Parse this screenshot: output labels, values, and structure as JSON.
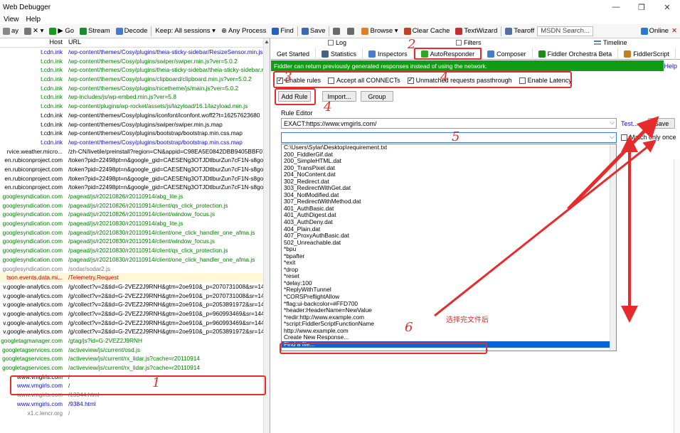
{
  "window": {
    "title": "Web Debugger",
    "minimize": "—",
    "restore": "❐",
    "close": "✕"
  },
  "menu": [
    "View",
    "Help"
  ],
  "toolbar": {
    "items": [
      {
        "label": "ay",
        "icon": "replay-icon",
        "color": "#888888"
      },
      {
        "label": "✕ ▾",
        "icon": "remove-icon",
        "color": "#777777"
      },
      {
        "label": "▶ Go",
        "icon": "go-icon",
        "color": "#1a9a1a"
      },
      {
        "label": "Stream",
        "icon": "stream-icon",
        "color": "#1b8a2c"
      },
      {
        "label": "Decode",
        "icon": "decode-icon",
        "color": "#4a7acb"
      },
      {
        "label": "Keep: All sessions ▾",
        "icon": "",
        "color": ""
      },
      {
        "label": "⊕ Any Process",
        "icon": "",
        "color": ""
      },
      {
        "label": "Find",
        "icon": "find-icon",
        "color": "#2060c0"
      },
      {
        "label": "Save",
        "icon": "save-icon",
        "color": "#3a6ab0"
      },
      {
        "label": "",
        "icon": "screenshot-icon",
        "color": "#6a6a6a"
      },
      {
        "label": "",
        "icon": "timer-icon",
        "color": "#6a6a6a"
      },
      {
        "label": "Browse ▾",
        "icon": "browse-icon",
        "color": "#e08020"
      },
      {
        "label": "Clear Cache",
        "icon": "clear-cache-icon",
        "color": "#c04020"
      },
      {
        "label": "TextWizard",
        "icon": "textwizard-icon",
        "color": "#c03030"
      },
      {
        "label": "Tearoff",
        "icon": "tearoff-icon",
        "color": "#5070a0"
      }
    ],
    "search_placeholder": "MSDN Search...",
    "online": "Online",
    "online_close": "✕"
  },
  "sessions": {
    "header_host": "Host",
    "header_url": "URL",
    "rows": [
      {
        "host": "t.cdn.ink",
        "url": "/wp-content/themes/Cosy/plugins/theia-sticky-sidebar/ResizeSensor.min.js?",
        "color": "blue",
        "bg": ""
      },
      {
        "host": "t.cdn.ink",
        "url": "/wp-content/themes/Cosy/plugins/swiper/swiper.min.js?ver=5.0.2",
        "color": "green",
        "bg": ""
      },
      {
        "host": "t.cdn.ink",
        "url": "/wp-content/themes/Cosy/plugins/theia-sticky-sidebar/theia-sticky-sidebar.r",
        "color": "green",
        "bg": ""
      },
      {
        "host": "t.cdn.ink",
        "url": "/wp-content/themes/Cosy/plugins/clipboard/clipboard.min.js?ver=5.0.2",
        "color": "green",
        "bg": ""
      },
      {
        "host": "t.cdn.ink",
        "url": "/wp-content/themes/Cosy/plugins/nicetheme/js/main.js?ver=5.0.2",
        "color": "green",
        "bg": ""
      },
      {
        "host": "t.cdn.ink",
        "url": "/wp-includes/js/wp-embed.min.js?ver=5.8",
        "color": "green",
        "bg": ""
      },
      {
        "host": "t.cdn.ink",
        "url": "/wp-content/plugins/wp-rocket/assets/js/lazyload/16.1/lazyload.min.js",
        "color": "green",
        "bg": ""
      },
      {
        "host": "t.cdn.ink",
        "url": "/wp-content/themes/Cosy/plugins/iconfont/iconfont.woff2?t=16257623680",
        "color": "black",
        "bg": ""
      },
      {
        "host": "t.cdn.ink",
        "url": "/wp-content/themes/Cosy/plugins/swiper/swiper.min.js.map",
        "color": "black",
        "bg": ""
      },
      {
        "host": "t.cdn.ink",
        "url": "/wp-content/themes/Cosy/plugins/bootstrap/bootstrap.min.css.map",
        "color": "black",
        "bg": ""
      },
      {
        "host": "t.cdn.ink",
        "url": "/wp-content/themes/Cosy/plugins/bootstrap/bootstrap.min.css.map",
        "color": "blue",
        "bg": ""
      },
      {
        "host": "rvice.weather.micro...",
        "url": "/zh-CN/livetile/preinstall?region=CN&appid=C98EA5E0842DBB9405BBF071E",
        "color": "black",
        "bg": ""
      },
      {
        "host": "en.rubiconproject.com",
        "url": "/token?pid=22498pt=n&google_gid=CAESENg3OTJDtlburZun7cF1N-s8goog",
        "color": "black",
        "bg": ""
      },
      {
        "host": "en.rubiconproject.com",
        "url": "/token?pid=22498pt=n&google_gid=CAESENg3OTJDtlburZun7cF1N-s8goog",
        "color": "black",
        "bg": ""
      },
      {
        "host": "en.rubiconproject.com",
        "url": "/token?pid=22498pt=n&google_gid=CAESENg3OTJDtlburZun7cF1N-s8goog",
        "color": "black",
        "bg": ""
      },
      {
        "host": "en.rubiconproject.com",
        "url": "/token?pid=22498pt=n&google_gid=CAESENg3OTJDtlburZun7cF1N-s8goog",
        "color": "black",
        "bg": ""
      },
      {
        "host": "googlesyndication.com",
        "url": "/pagead/js/r20210826/r20110914/abg_lite.js",
        "color": "green",
        "bg": ""
      },
      {
        "host": "googlesyndication.com",
        "url": "/pagead/js/r20210826/r20110914/client/qs_click_protection.js",
        "color": "green",
        "bg": ""
      },
      {
        "host": "googlesyndication.com",
        "url": "/pagead/js/r20210826/r20110914/client/window_focus.js",
        "color": "green",
        "bg": ""
      },
      {
        "host": "googlesyndication.com",
        "url": "/pagead/js/r20210830/r20110914/abg_lite.js",
        "color": "green",
        "bg": ""
      },
      {
        "host": "googlesyndication.com",
        "url": "/pagead/js/r20210830/r20110914/client/one_click_handler_one_afma.js",
        "color": "green",
        "bg": ""
      },
      {
        "host": "googlesyndication.com",
        "url": "/pagead/js/r20210830/r20110914/client/window_focus.js",
        "color": "green",
        "bg": ""
      },
      {
        "host": "googlesyndication.com",
        "url": "/pagead/js/r20210830/r20110914/client/qs_click_protection.js",
        "color": "green",
        "bg": ""
      },
      {
        "host": "googlesyndication.com",
        "url": "/pagead/js/r20210830/r20110914/client/one_click_handler_one_afma.js",
        "color": "green",
        "bg": ""
      },
      {
        "host": "googlesyndication.com",
        "url": "/sodar/sodar2.js",
        "color": "gray",
        "bg": ""
      },
      {
        "host": "tson.events.data.mi...",
        "url": "/Telemetry.Request",
        "color": "red",
        "bg": "y"
      },
      {
        "host": "v.google-analytics.com",
        "url": "/g/collect?v=2&tid=G-2VEZ2J9RNH&gtm=2oe910&_p=2070731008&sr=144",
        "color": "black",
        "bg": ""
      },
      {
        "host": "v.google-analytics.com",
        "url": "/g/collect?v=2&tid=G-2VEZ2J9RNH&gtm=2oe910&_p=2070731008&sr=144",
        "color": "black",
        "bg": ""
      },
      {
        "host": "v.google-analytics.com",
        "url": "/g/collect?v=2&tid=G-2VEZ2J9RNH&gtm=2oe910&_p=2053891972&sr=144",
        "color": "black",
        "bg": ""
      },
      {
        "host": "v.google-analytics.com",
        "url": "/g/collect?v=2&tid=G-2VEZ2J9RNH&gtm=2oe910&_p=960993469&sr=1440",
        "color": "black",
        "bg": ""
      },
      {
        "host": "v.google-analytics.com",
        "url": "/g/collect?v=2&tid=G-2VEZ2J9RNH&gtm=2oe910&_p=960993469&sr=1440",
        "color": "black",
        "bg": ""
      },
      {
        "host": "v.google-analytics.com",
        "url": "/g/collect?v=2&tid=G-2VEZ2J9RNH&gtm=2oe910&_p=2053891972&sr=144",
        "color": "black",
        "bg": ""
      },
      {
        "host": "googletagmanager.com",
        "url": "/gtag/js?id=G-2VEZ2J9RNH",
        "color": "green",
        "bg": ""
      },
      {
        "host": "googletagservices.com",
        "url": "/activeview/js/current/osd.js",
        "color": "green",
        "bg": ""
      },
      {
        "host": "googletagservices.com",
        "url": "/activeview/js/current/rx_lidar.js?cache=r20110914",
        "color": "green",
        "bg": ""
      },
      {
        "host": "googletagservices.com",
        "url": "/activeview/js/current/rx_lidar.js?cache=r20110914",
        "color": "green",
        "bg": ""
      },
      {
        "host": "www.vmgirls.com",
        "url": "/",
        "color": "black",
        "bg": ""
      },
      {
        "host": "www.vmgirls.com",
        "url": "/",
        "color": "blue",
        "bg": ""
      },
      {
        "host": "www.vmgirls.com",
        "url": "/13344.html",
        "color": "gray",
        "bg": ""
      },
      {
        "host": "www.vmgirls.com",
        "url": "/9384.html",
        "color": "blue",
        "bg": ""
      },
      {
        "host": "x1.c.lencr.org",
        "url": "/",
        "color": "gray",
        "bg": ""
      }
    ]
  },
  "tabs_top": [
    {
      "label": "Log",
      "icon": "log-icon"
    },
    {
      "label": "Filters",
      "icon": "filters-icon"
    },
    {
      "label": "Timeline",
      "icon": "timeline-icon"
    }
  ],
  "tabs": [
    {
      "label": "Get Started",
      "icon": "",
      "color": ""
    },
    {
      "label": "Statistics",
      "icon": "statistics-icon",
      "color": "#4a6080"
    },
    {
      "label": "Inspectors",
      "icon": "inspectors-icon",
      "color": "#4a7acb"
    },
    {
      "label": "AutoResponder",
      "icon": "autoresponder-icon",
      "color": "#2aa820",
      "active": true
    },
    {
      "label": "Composer",
      "icon": "composer-icon",
      "color": "#4a7acb"
    },
    {
      "label": "Fiddler Orchestra Beta",
      "icon": "fo-icon",
      "color": "#1a8a1a"
    },
    {
      "label": "FiddlerScript",
      "icon": "fiddlerscript-icon",
      "color": "#c08020"
    }
  ],
  "banner": "Fiddler can return previously generated responses instead of using the network.",
  "help": "Help",
  "options": {
    "enable_rules": "Enable rules",
    "accept_connects": "Accept all CONNECTs",
    "unmatched": "Unmatched requests passthrough",
    "latency": "Enable Latency"
  },
  "buttons": {
    "add_rule": "Add Rule",
    "import": "Import...",
    "group": "Group",
    "save": "Save"
  },
  "rule_editor": {
    "label": "Rule Editor",
    "match_value": "EXACT:https://www.vmgirls.com/",
    "action_value": "",
    "test": "Test...",
    "match_once": "Match only once"
  },
  "dropdown_items": [
    "C:\\Users\\Sylar\\Desktop\\requirement.txt",
    "200_FiddlerGif.dat",
    "200_SimpleHTML.dat",
    "200_TransPixel.dat",
    "204_NoContent.dat",
    "302_Redirect.dat",
    "303_RedirectWithGet.dat",
    "304_NotModified.dat",
    "307_RedirectWithMethod.dat",
    "401_AuthBasic.dat",
    "401_AuthDigest.dat",
    "403_AuthDeny.dat",
    "404_Plain.dat",
    "407_ProxyAuthBasic.dat",
    "502_Unreachable.dat",
    "*bpu",
    "*bpafter",
    "*exit",
    "*drop",
    "*reset",
    "*delay:100",
    "*ReplyWithTunnel",
    "*CORSPreflightAllow",
    "*flag:ui-backcolor=#FFD700",
    "*header:HeaderName=NewValue",
    "*redir:http://www.example.com",
    "*script:FiddlerScriptFunctionName",
    "http://www.example.com",
    "Create New Response...",
    "Find a file..."
  ],
  "annotations": {
    "n1": "1",
    "n2": "2",
    "n3": "3",
    "n4a": "4",
    "n4b": "4",
    "n5": "5",
    "n6": "6",
    "note": "选择完文件后",
    "color": "#e52b2b"
  }
}
